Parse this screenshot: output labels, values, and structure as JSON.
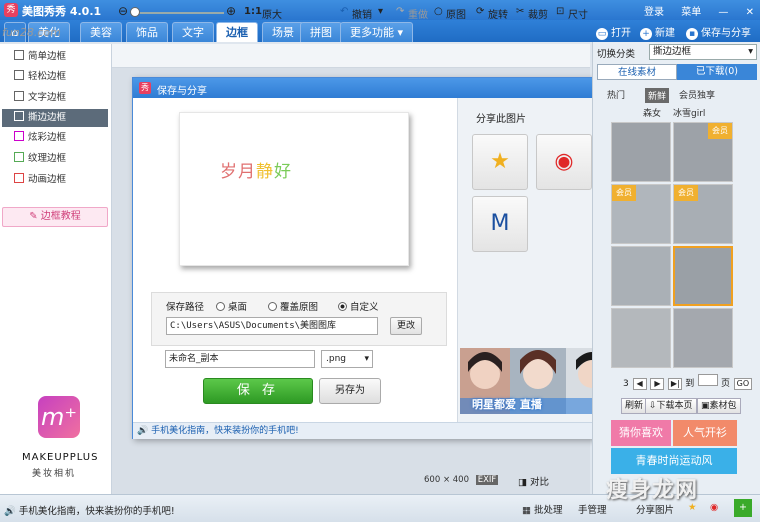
{
  "app": {
    "title": "美图秀秀 4.0.1",
    "logo_glyph": "秀"
  },
  "titlebar": {
    "login": "登录",
    "menu": "菜单"
  },
  "menubar": {
    "tabs": [
      "美化",
      "美容",
      "饰品",
      "文字",
      "边框",
      "场景",
      "拼图",
      "更多功能 ▾"
    ],
    "active": "边框",
    "open": "打开",
    "new": "新建",
    "save_share": "保存与分享"
  },
  "sidebar": {
    "items": [
      "简单边框",
      "轻松边框",
      "文字边框",
      "撕边边框",
      "炫彩边框",
      "纹理边框",
      "动画边框"
    ],
    "active": "撕边边框",
    "tutorial": "边框教程"
  },
  "ad": {
    "name": "MAKEUPPLUS",
    "sub": "美妆相机",
    "logo_glyph": "m⁺"
  },
  "toolbar": {
    "zoom_ratio": "1:1",
    "original_size": "原大",
    "undo": "撤销",
    "redo": "重做",
    "original": "原图",
    "rotate": "旋转",
    "crop": "裁剪",
    "resize": "尺寸"
  },
  "dialog": {
    "title": "保存与分享",
    "preview_text_a": "岁月",
    "preview_text_b": "静",
    "preview_text_c": "好",
    "path_label": "保存路径",
    "options": [
      "桌面",
      "覆盖原图",
      "自定义"
    ],
    "selected": "自定义",
    "path": "C:\\Users\\ASUS\\Documents\\美图图库",
    "change": "更改",
    "filename": "未命名_副本",
    "format": ".png",
    "save": "保 存",
    "save_as": "另存为",
    "share_label": "分享此图片",
    "banner_text": "明星都爱 直播",
    "footer": "手机美化指南，快来装扮你的手机吧!"
  },
  "right_panel": {
    "switch_label": "切换分类",
    "category": "撕边边框",
    "tabs": [
      "在线素材",
      "已下载(0)"
    ],
    "subcats": [
      "热门",
      "新鲜",
      "会员独享",
      "森女",
      "冰雪girl"
    ],
    "active_subcat": "新鲜",
    "page_current": "3",
    "page_label_to": "到",
    "page_label_page": "页",
    "go": "GO",
    "refresh": "刷新",
    "download_page": "下载本页",
    "library": "素材包",
    "promo1": "猜你喜欢",
    "promo2": "人气开衫",
    "promo3": "青春时尚运动风",
    "vip": "会员"
  },
  "canvas": {
    "width": "600",
    "times": "×",
    "height": "400",
    "exif": "EXIF",
    "compare": "对比"
  },
  "statusbar": {
    "message": "手机美化指南，快来装扮你的手机吧!",
    "batch": "批处理",
    "manage": "手管理",
    "share_image": "分享图片"
  },
  "watermark": "瘦身龙网",
  "site_mark": "fun28.com"
}
